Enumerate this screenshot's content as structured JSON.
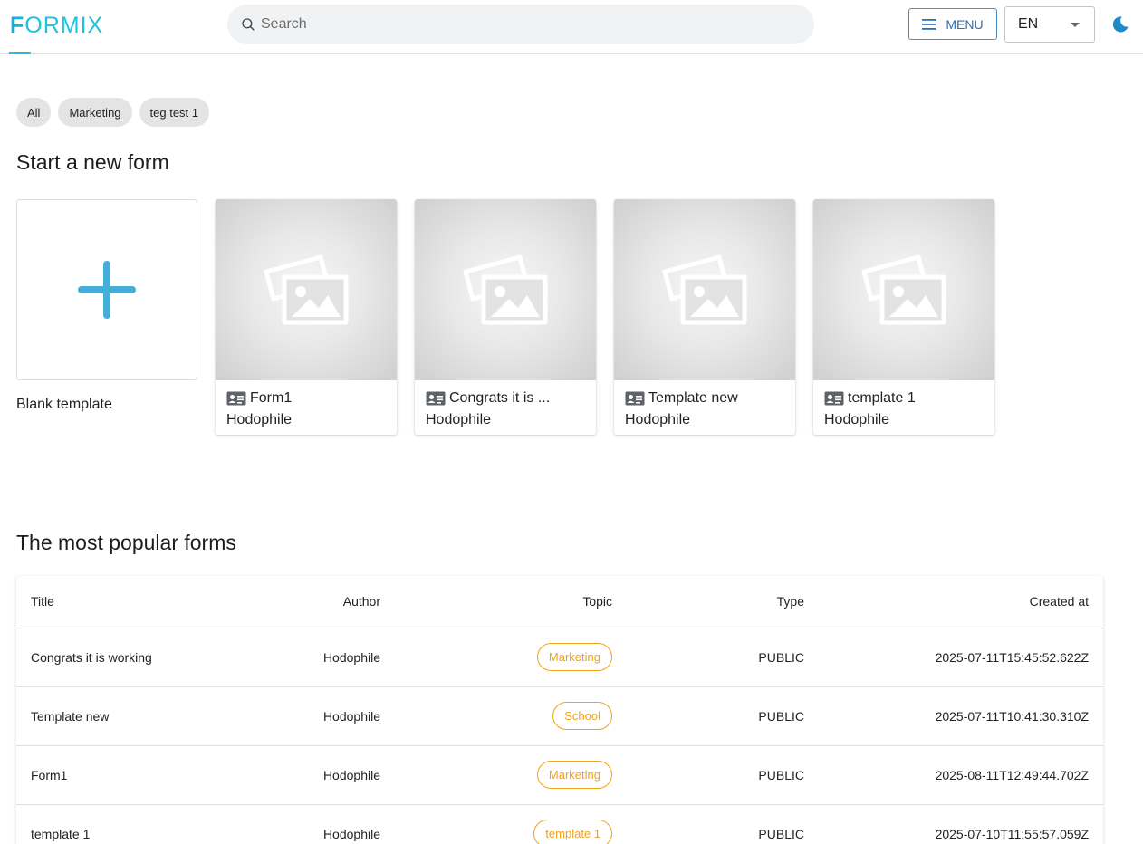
{
  "header": {
    "logo_first": "F",
    "logo_rest": "ORMIX",
    "search_placeholder": "Search",
    "menu_label": "MENU",
    "language": "EN"
  },
  "chips": [
    "All",
    "Marketing",
    "teg test 1"
  ],
  "new_form": {
    "title": "Start a new form",
    "blank_label": "Blank template",
    "templates": [
      {
        "title": "Form1",
        "author": "Hodophile"
      },
      {
        "title": "Congrats it is ...",
        "author": "Hodophile"
      },
      {
        "title": "Template new",
        "author": "Hodophile"
      },
      {
        "title": "template 1",
        "author": "Hodophile"
      }
    ]
  },
  "popular": {
    "title": "The most popular forms",
    "columns": [
      "Title",
      "Author",
      "Topic",
      "Type",
      "Created at"
    ],
    "rows": [
      {
        "title": "Congrats it is working",
        "author": "Hodophile",
        "topic": "Marketing",
        "type": "PUBLIC",
        "created": "2025-07-11T15:45:52.622Z"
      },
      {
        "title": "Template new",
        "author": "Hodophile",
        "topic": "School",
        "type": "PUBLIC",
        "created": "2025-07-11T10:41:30.310Z"
      },
      {
        "title": "Form1",
        "author": "Hodophile",
        "topic": "Marketing",
        "type": "PUBLIC",
        "created": "2025-08-11T12:49:44.702Z"
      },
      {
        "title": "template 1",
        "author": "Hodophile",
        "topic": "template 1",
        "type": "PUBLIC",
        "created": "2025-07-10T11:55:57.059Z"
      }
    ]
  },
  "colors": {
    "brand": "#1fc0e0",
    "accent_blue": "#2e6fb0",
    "plus": "#45aed6",
    "topic": "#f0a21a"
  },
  "icons": {
    "search": "search-icon",
    "menu": "hamburger-icon",
    "dropdown": "chevron-down-icon",
    "theme": "moon-icon",
    "blank": "plus-icon",
    "placeholder": "image-placeholder-icon",
    "template": "id-card-icon"
  }
}
